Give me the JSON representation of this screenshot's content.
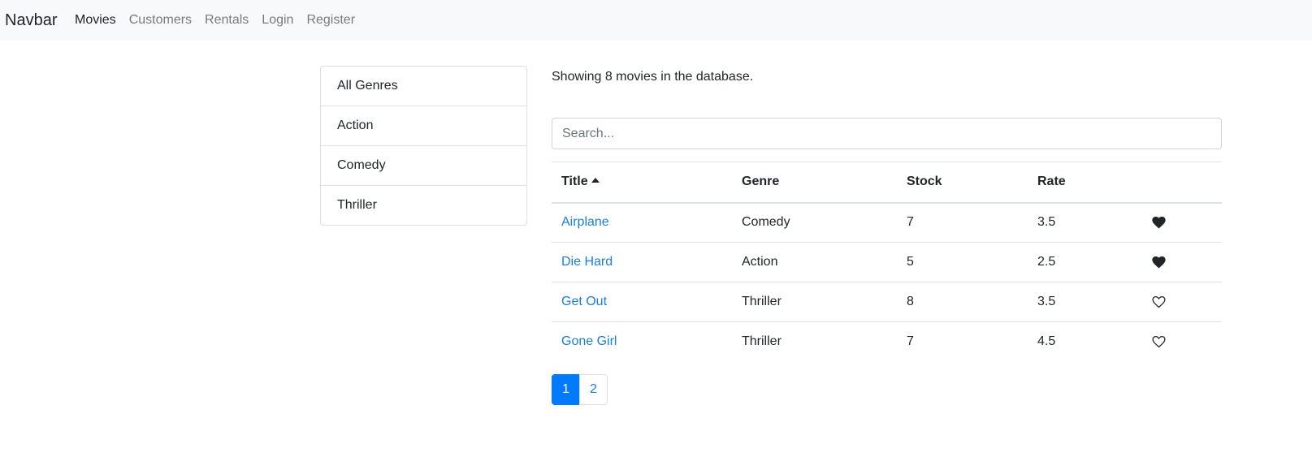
{
  "navbar": {
    "brand": "Navbar",
    "links": [
      {
        "label": "Movies",
        "active": true
      },
      {
        "label": "Customers",
        "active": false
      },
      {
        "label": "Rentals",
        "active": false
      },
      {
        "label": "Login",
        "active": false
      },
      {
        "label": "Register",
        "active": false
      }
    ]
  },
  "genres": {
    "items": [
      "All Genres",
      "Action",
      "Comedy",
      "Thriller"
    ]
  },
  "main": {
    "count_text": "Showing 8 movies in the database.",
    "search": {
      "placeholder": "Search...",
      "value": ""
    }
  },
  "table": {
    "headers": {
      "title": "Title",
      "genre": "Genre",
      "stock": "Stock",
      "rate": "Rate"
    },
    "sort_icon": "caret-up-icon",
    "rows": [
      {
        "title": "Airplane",
        "genre": "Comedy",
        "stock": "7",
        "rate": "3.5",
        "liked": true
      },
      {
        "title": "Die Hard",
        "genre": "Action",
        "stock": "5",
        "rate": "2.5",
        "liked": true
      },
      {
        "title": "Get Out",
        "genre": "Thriller",
        "stock": "8",
        "rate": "3.5",
        "liked": false
      },
      {
        "title": "Gone Girl",
        "genre": "Thriller",
        "stock": "7",
        "rate": "4.5",
        "liked": false
      }
    ]
  },
  "pagination": {
    "pages": [
      "1",
      "2"
    ],
    "current": "1"
  },
  "colors": {
    "accent": "#007bff",
    "link": "#1a7fd8",
    "navbar_bg": "#f8f9fa"
  }
}
